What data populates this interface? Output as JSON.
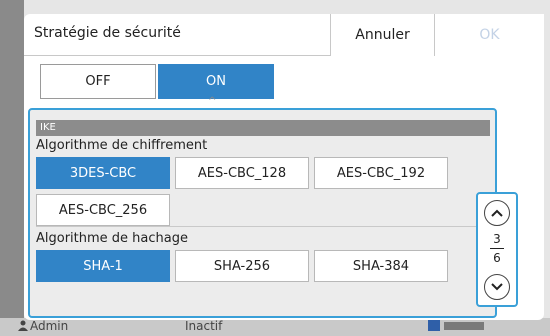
{
  "background": {
    "user_label": "Admin",
    "state_label": "Inactif"
  },
  "dialog": {
    "title": "Stratégie de sécurité",
    "cancel_label": "Annuler",
    "ok_label": "OK",
    "toggle": {
      "off_label": "OFF",
      "on_label": "ON",
      "selected": "ON"
    }
  },
  "panel": {
    "section_header": "IKE",
    "encryption": {
      "label": "Algorithme de chiffrement",
      "options": [
        "3DES-CBC",
        "AES-CBC_128",
        "AES-CBC_192",
        "AES-CBC_256"
      ],
      "selected": "3DES-CBC"
    },
    "hash": {
      "label": "Algorithme de hachage",
      "options": [
        "SHA-1",
        "SHA-256",
        "SHA-384"
      ],
      "selected": "SHA-1"
    }
  },
  "pager": {
    "current": "3",
    "total": "6"
  },
  "colors": {
    "accent": "#3184c7",
    "highlight_border": "#3aa0d8",
    "ok_disabled": "#c3d2e6"
  }
}
